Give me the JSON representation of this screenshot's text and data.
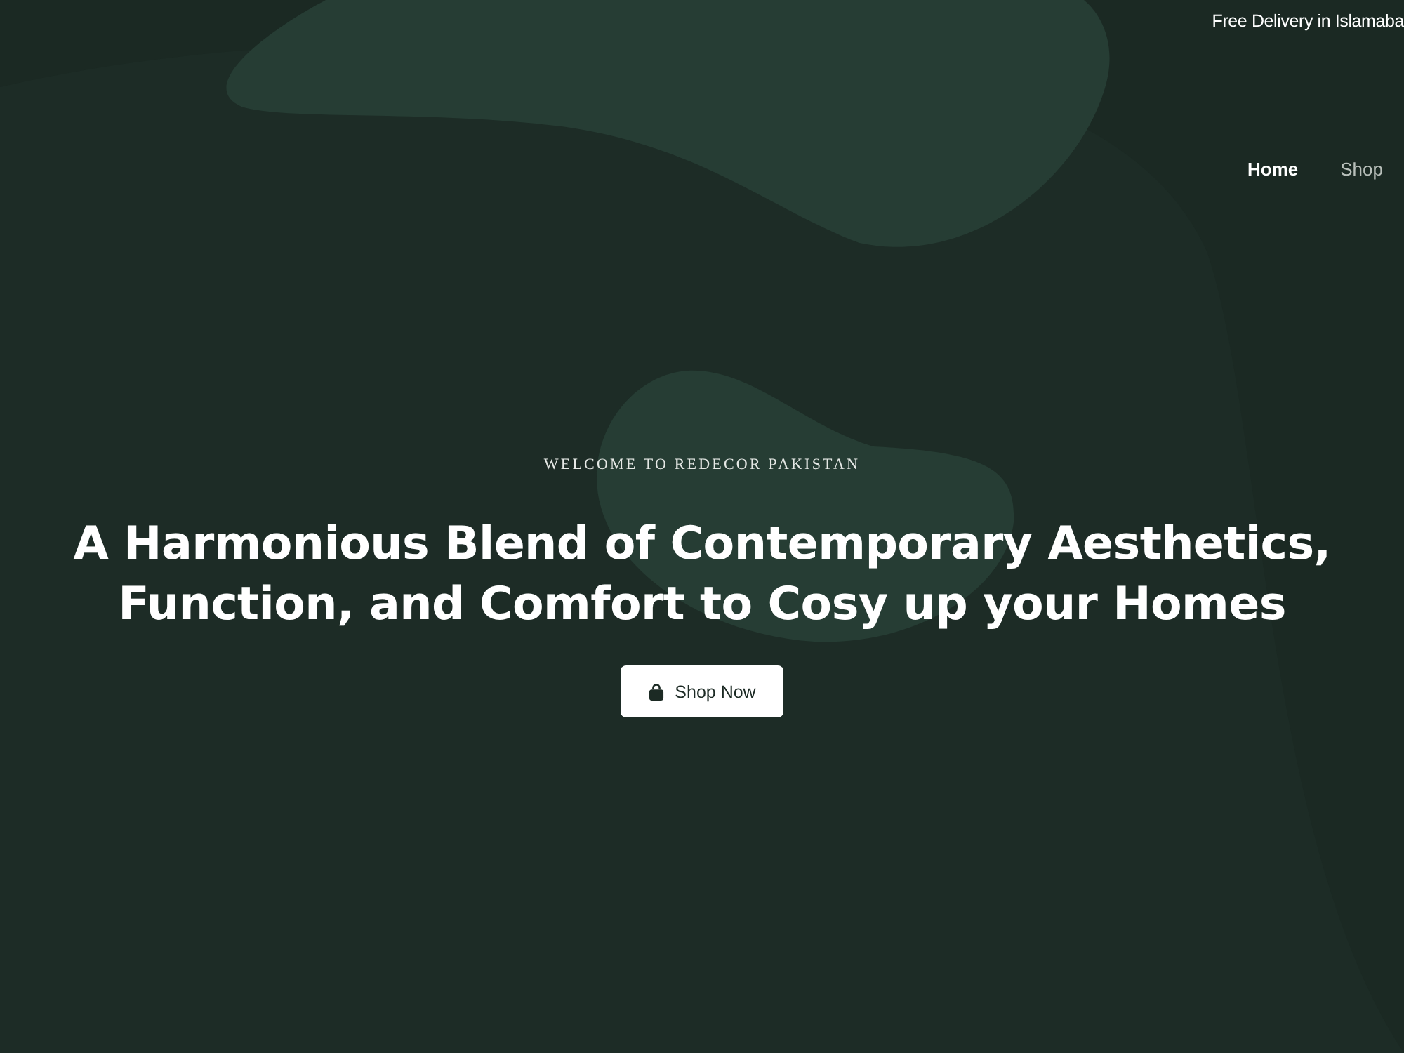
{
  "top_bar": {
    "text": "Free Delivery in Islamaba"
  },
  "nav": {
    "items": [
      {
        "label": "Home",
        "selected": true
      },
      {
        "label": "Shop",
        "selected": false
      }
    ]
  },
  "hero": {
    "eyebrow": "WELCOME TO REDECOR PAKISTAN",
    "heading": "A Harmonious Blend of Contemporary Aesthetics, Function, and Comfort to Cosy up your Homes",
    "button": {
      "label": "Shop Now"
    }
  }
}
